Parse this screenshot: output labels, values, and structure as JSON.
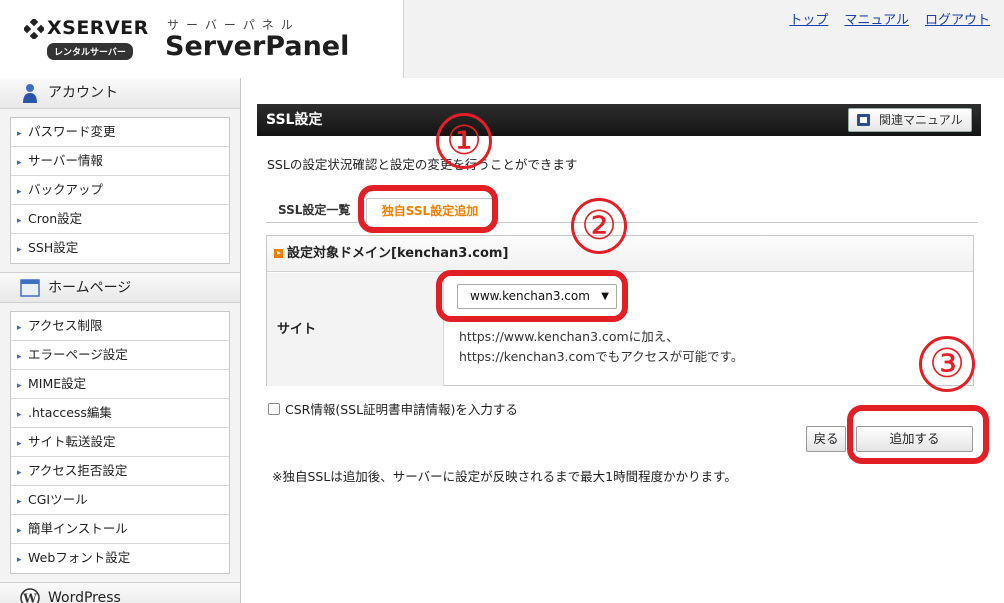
{
  "header": {
    "logo": {
      "brand": "XSERVER",
      "tagline": "レンタルサーバー",
      "sub": "サーバーパネル",
      "product": "ServerPanel"
    },
    "nav": [
      {
        "label": "トップ"
      },
      {
        "label": "マニュアル"
      },
      {
        "label": "ログアウト"
      }
    ]
  },
  "sidebar": {
    "sections": [
      {
        "title": "アカウント",
        "icon": "user-icon",
        "items": [
          "パスワード変更",
          "サーバー情報",
          "バックアップ",
          "Cron設定",
          "SSH設定"
        ]
      },
      {
        "title": "ホームページ",
        "icon": "window-icon",
        "items": [
          "アクセス制限",
          "エラーページ設定",
          "MIME設定",
          ".htaccess編集",
          "サイト転送設定",
          "アクセス拒否設定",
          "CGIツール",
          "簡単インストール",
          "Webフォント設定"
        ]
      },
      {
        "title": "WordPress",
        "icon": "wordpress-icon",
        "items": []
      }
    ]
  },
  "main": {
    "title": "SSL設定",
    "manual_label": "関連マニュアル",
    "description": "SSLの設定状況確認と設定の変更を行うことができます",
    "tabs": [
      {
        "label": "SSL設定一覧"
      },
      {
        "label": "独自SSL設定追加"
      }
    ],
    "form": {
      "heading": "設定対象ドメイン[kenchan3.com]",
      "site_label": "サイト",
      "select_value": "www.kenchan3.com",
      "hint_line1": "https://www.kenchan3.comに加え、",
      "hint_line2": "https://kenchan3.comでもアクセスが可能です。"
    },
    "csr_label": "CSR情報(SSL証明書申請情報)を入力する",
    "back_label": "戻る",
    "add_label": "追加する",
    "note": "※独自SSLは追加後、サーバーに設定が反映されるまで最大1時間程度かかります。"
  },
  "annotations": {
    "n1": "①",
    "n2": "②",
    "n3": "③",
    "color": "#e31f26"
  },
  "colors": {
    "accent_orange": "#f08000",
    "link_blue": "#1a3fa8",
    "title_bar": "#1e1e1e"
  }
}
